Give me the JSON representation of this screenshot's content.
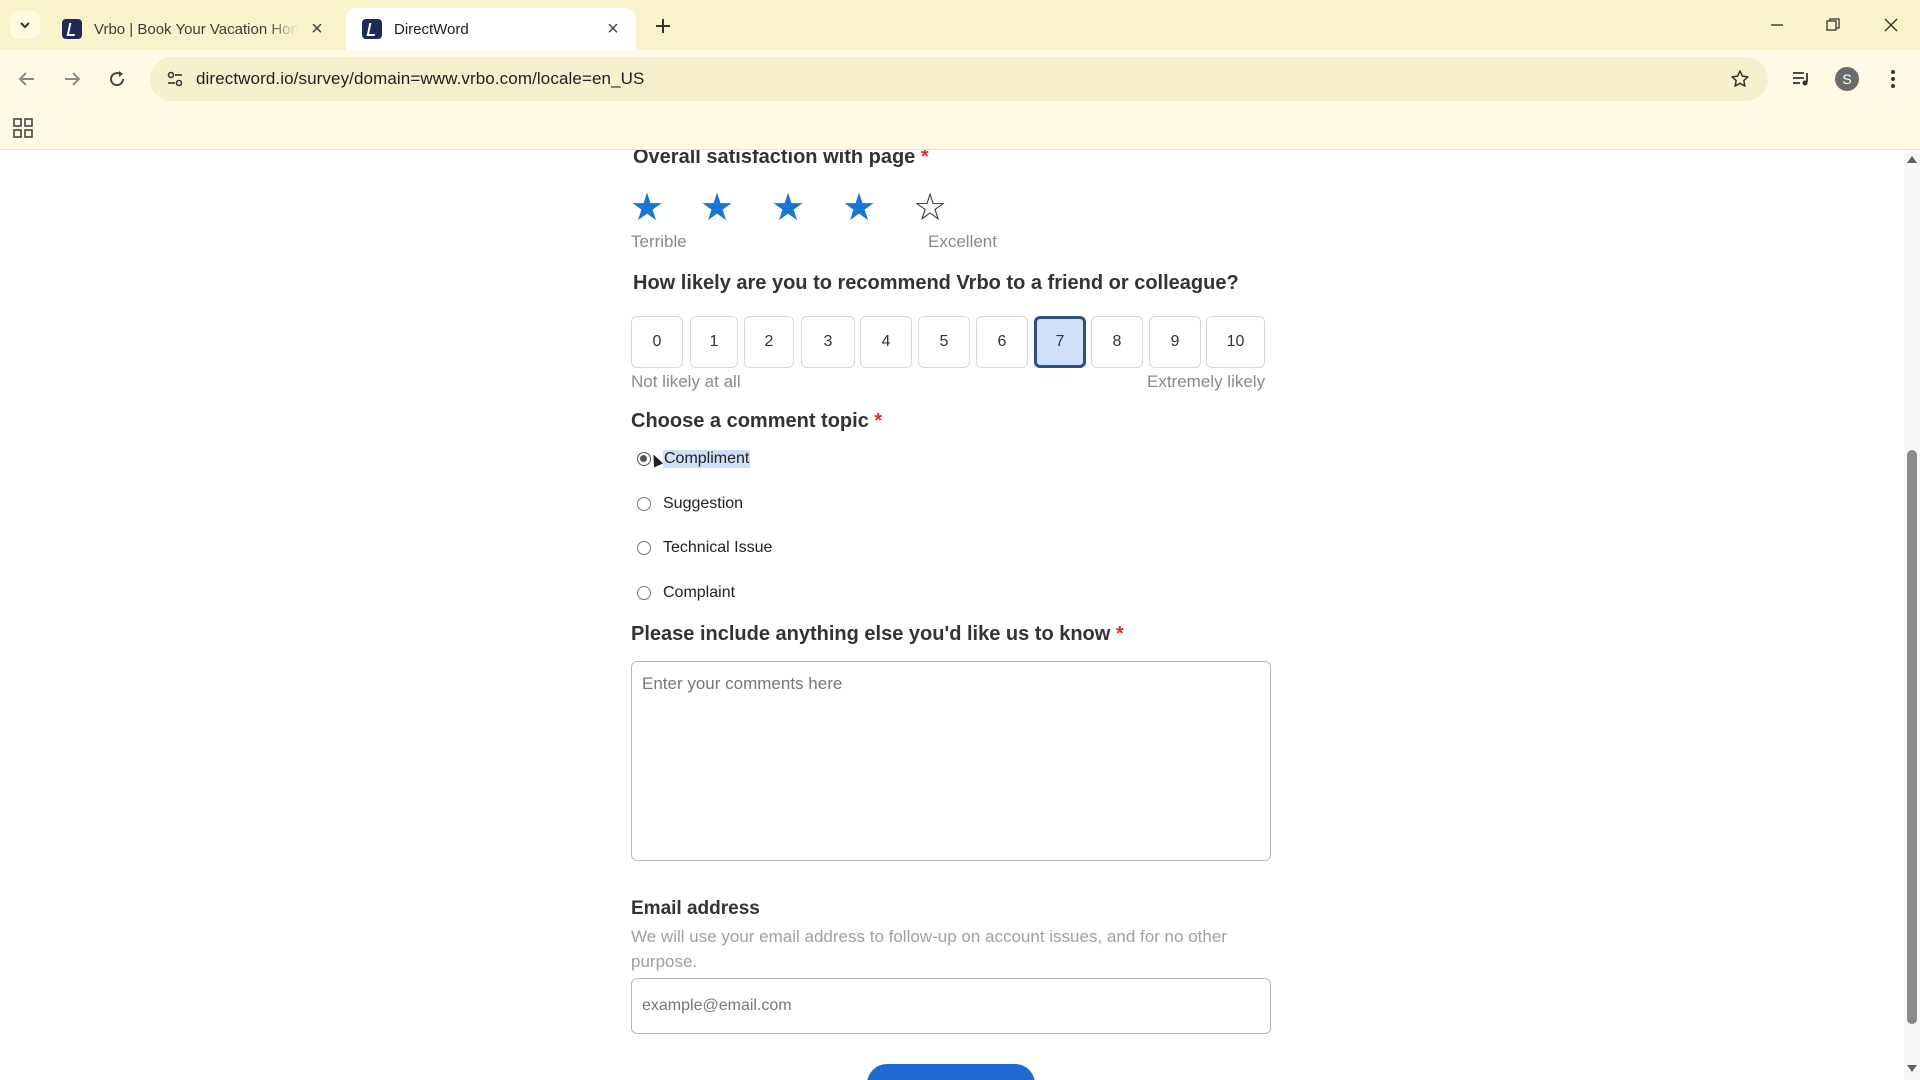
{
  "browser": {
    "tabs": [
      {
        "title": "Vrbo | Book Your Vacation Hom",
        "active": false
      },
      {
        "title": "DirectWord",
        "active": true
      }
    ],
    "url": "directword.io/survey/domain=www.vrbo.com/locale=en_US",
    "profile_initial": "S"
  },
  "survey": {
    "satisfaction": {
      "question": "Overall satisfaction with page",
      "required_mark": "*",
      "rating": 4,
      "max_rating": 5,
      "low_label": "Terrible",
      "high_label": "Excellent"
    },
    "recommend": {
      "question": "How likely are you to recommend Vrbo to a friend or colleague?",
      "options": [
        "0",
        "1",
        "2",
        "3",
        "4",
        "5",
        "6",
        "7",
        "8",
        "9",
        "10"
      ],
      "selected": "7",
      "low_label": "Not likely at all",
      "high_label": "Extremely likely"
    },
    "topic": {
      "question": "Choose a comment topic",
      "required_mark": "*",
      "options": [
        "Compliment",
        "Suggestion",
        "Technical Issue",
        "Complaint"
      ],
      "selected": "Compliment"
    },
    "comments": {
      "question": "Please include anything else you'd like us to know",
      "required_mark": "*",
      "placeholder": "Enter your comments here",
      "value": ""
    },
    "email": {
      "label": "Email address",
      "hint": "We will use your email address to follow-up on account issues, and for no other purpose.",
      "placeholder": "example@email.com",
      "value": ""
    }
  },
  "colors": {
    "accent": "#1976d2",
    "selected_bg": "#cfe0f8",
    "required": "#d32f2f",
    "tabstrip_bg": "#f9f3cc"
  }
}
